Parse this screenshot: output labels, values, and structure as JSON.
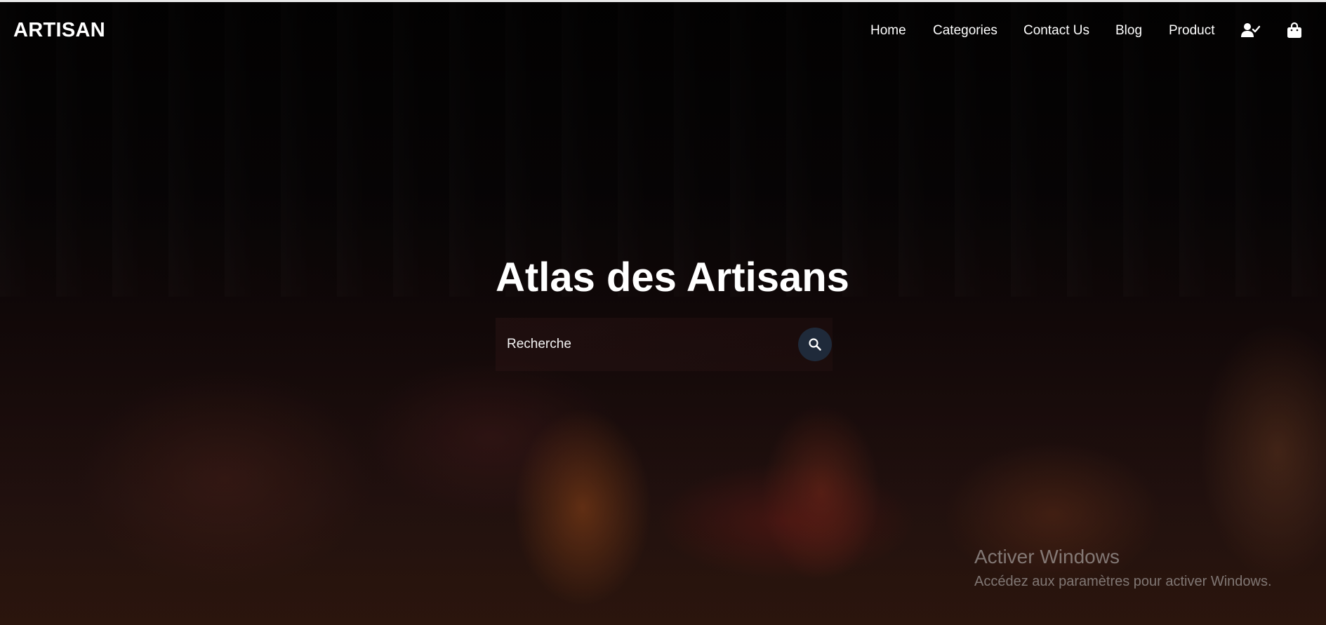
{
  "brand": {
    "logo_text": "ARTISAN"
  },
  "nav": {
    "items": [
      {
        "label": "Home"
      },
      {
        "label": "Categories"
      },
      {
        "label": "Contact Us"
      },
      {
        "label": "Blog"
      },
      {
        "label": "Product"
      }
    ],
    "user_icon": "user-check-icon",
    "cart_icon": "shopping-bag-icon"
  },
  "hero": {
    "title": "Atlas des Artisans",
    "search": {
      "placeholder": "Recherche",
      "button_icon": "search-icon"
    }
  },
  "os_watermark": {
    "title": "Activer Windows",
    "subtitle": "Accédez aux paramètres pour activer Windows."
  },
  "colors": {
    "search_button": "#1f2a3a",
    "text": "#ffffff",
    "top_line": "#e9e9e9"
  }
}
